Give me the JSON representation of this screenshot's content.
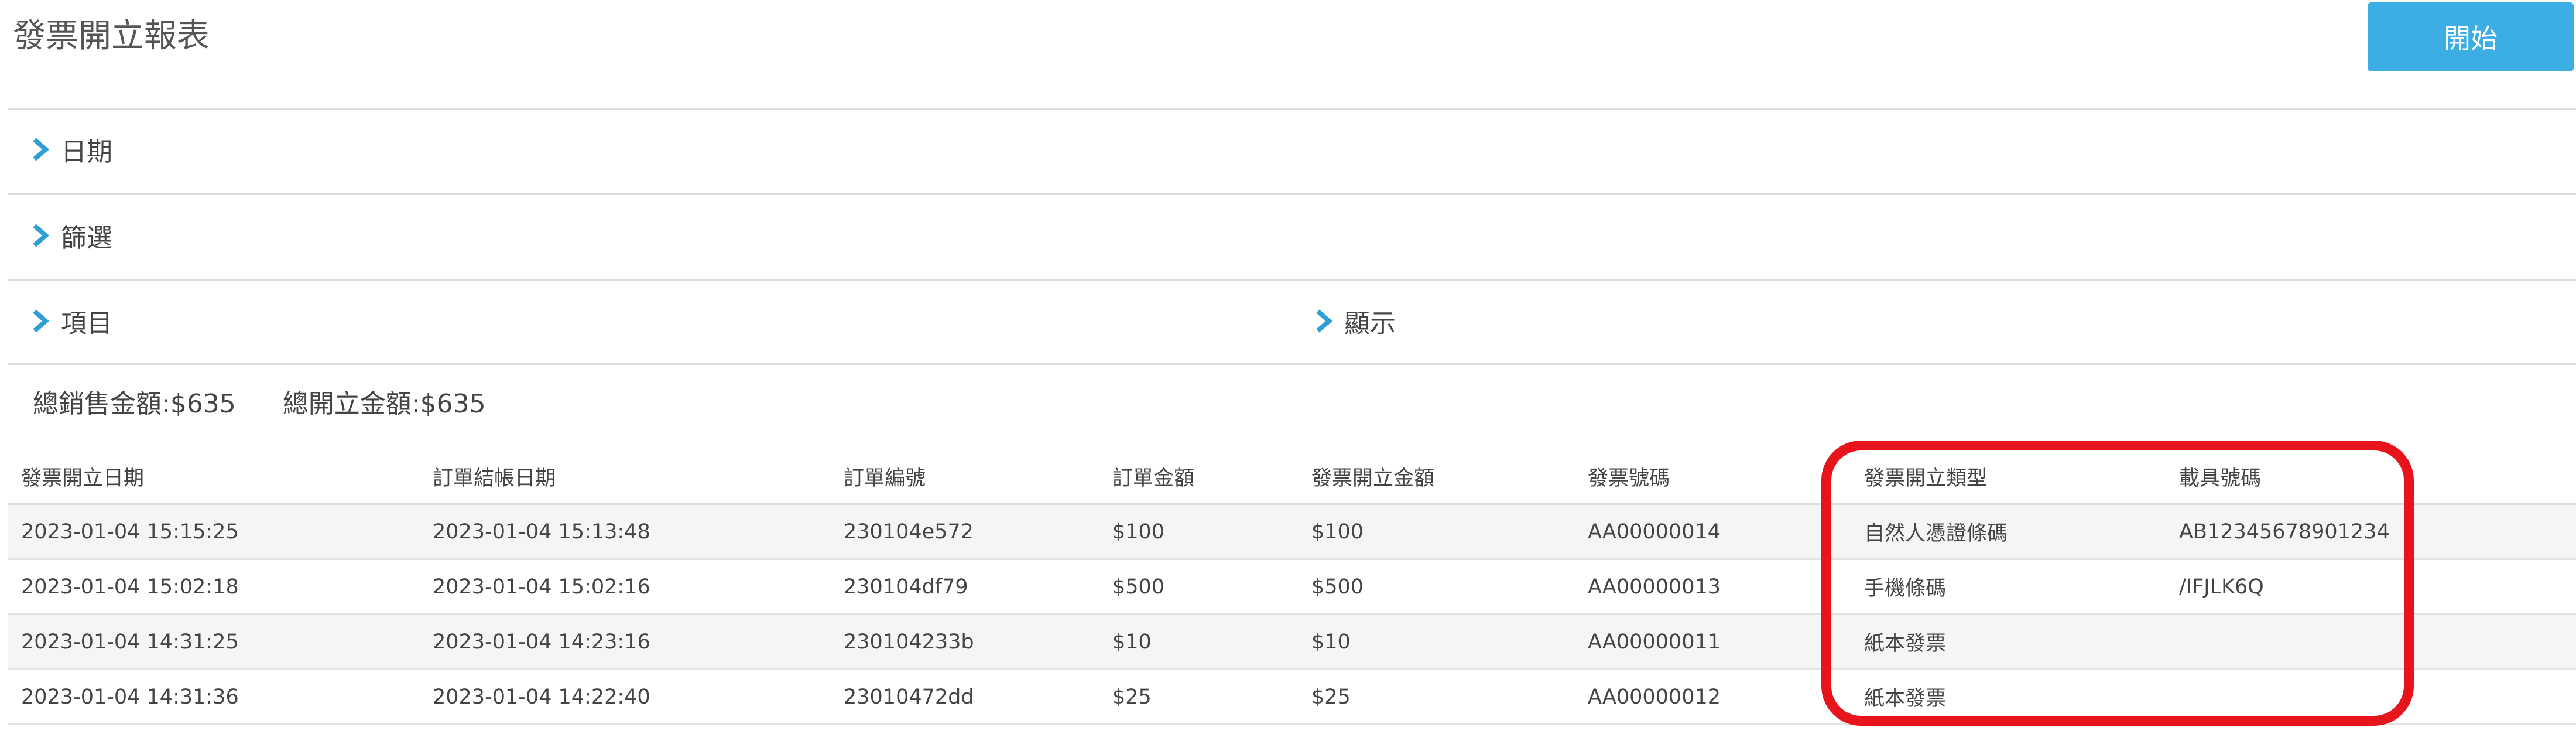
{
  "page": {
    "title": "發票開立報表",
    "start_label": "開始"
  },
  "sections": {
    "date_label": "日期",
    "filter_label": "篩選",
    "items_label": "項目",
    "display_label": "顯示"
  },
  "totals": {
    "sales": "總銷售金額:$635",
    "issued": "總開立金額:$635"
  },
  "table": {
    "headers": [
      "發票開立日期",
      "訂單結帳日期",
      "訂單編號",
      "訂單金額",
      "發票開立金額",
      "發票號碼",
      "發票開立類型",
      "載具號碼"
    ],
    "rows": [
      [
        "2023-01-04 15:15:25",
        "2023-01-04 15:13:48",
        "230104e572",
        "$100",
        "$100",
        "AA00000014",
        "自然人憑證條碼",
        "AB12345678901234"
      ],
      [
        "2023-01-04 15:02:18",
        "2023-01-04 15:02:16",
        "230104df79",
        "$500",
        "$500",
        "AA00000013",
        "手機條碼",
        "/IFJLK6Q"
      ],
      [
        "2023-01-04 14:31:25",
        "2023-01-04 14:23:16",
        "230104233b",
        "$10",
        "$10",
        "AA00000011",
        "紙本發票",
        ""
      ],
      [
        "2023-01-04 14:31:36",
        "2023-01-04 14:22:40",
        "23010472dd",
        "$25",
        "$25",
        "AA00000012",
        "紙本發票",
        ""
      ]
    ]
  },
  "colors": {
    "accent": "#3daee3",
    "chevron": "#2f9fd8",
    "highlight": "#e8141c"
  },
  "icons": {
    "chevron": "chevron-right-icon"
  }
}
